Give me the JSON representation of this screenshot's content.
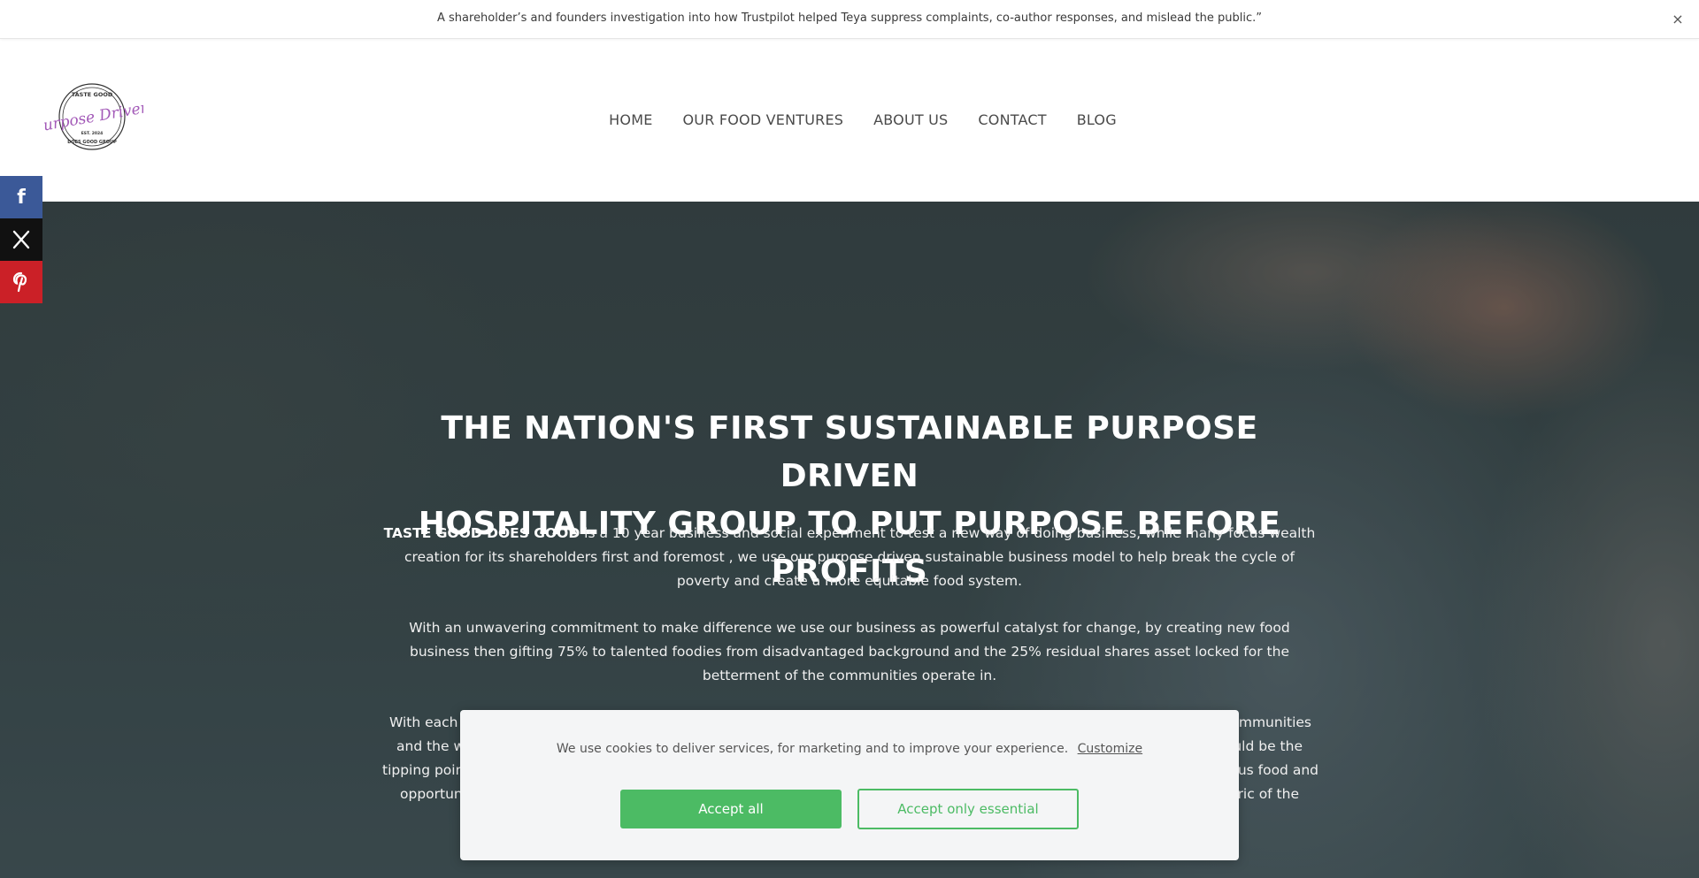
{
  "announcement": {
    "text": "A shareholder’s  and founders investigation into how Trustpilot helped Teya suppress complaints, co-author responses, and mislead the public.”",
    "close_symbol": "×"
  },
  "logo": {
    "top_text": "TASTE GOOD",
    "script_text": "Purpose Driven",
    "est_text": "EST. 2024",
    "bottom_text": "DOES GOOD GROUP"
  },
  "nav": {
    "items": [
      {
        "label": "HOME"
      },
      {
        "label": "OUR FOOD VENTURES"
      },
      {
        "label": "ABOUT US"
      },
      {
        "label": "CONTACT"
      },
      {
        "label": "BLOG"
      }
    ]
  },
  "social": {
    "facebook": "f",
    "x": "X",
    "pinterest": "P"
  },
  "hero": {
    "title_line1": "THE NATION'S FIRST SUSTAINABLE PURPOSE DRIVEN",
    "title_line2": "HOSPITALITY GROUP TO PUT PURPOSE BEFORE PROFITS",
    "p1_strong": "TASTE GOOD DOES GOOD",
    "p1_rest": " is a 10 year business and social experiment to test a new way of doing business, while many focus wealth creation for its shareholders first and foremost , we use our purpose driven sustainable business model to help break the cycle of poverty and create a more equitable food system.",
    "p2": "With an unwavering commitment to make difference we use our business as powerful catalyst for change, by creating new food business then gifting 75% to talented foodies from disadvantaged background and the 25% residual shares asset locked for the betterment of the communities operate in.",
    "p3_visible_left": [
      "With each",
      "and the w",
      "tipping point",
      "opportun"
    ],
    "p3_visible_right": [
      "ommunities",
      "uld be the",
      "us food and",
      "ric of the"
    ]
  },
  "cookie": {
    "message": "We use cookies to deliver services, for marketing and to improve your experience.",
    "customize_label": "Customize",
    "accept_all_label": "Accept all",
    "accept_essential_label": "Accept only essential",
    "accent_color": "#4cbb64"
  }
}
